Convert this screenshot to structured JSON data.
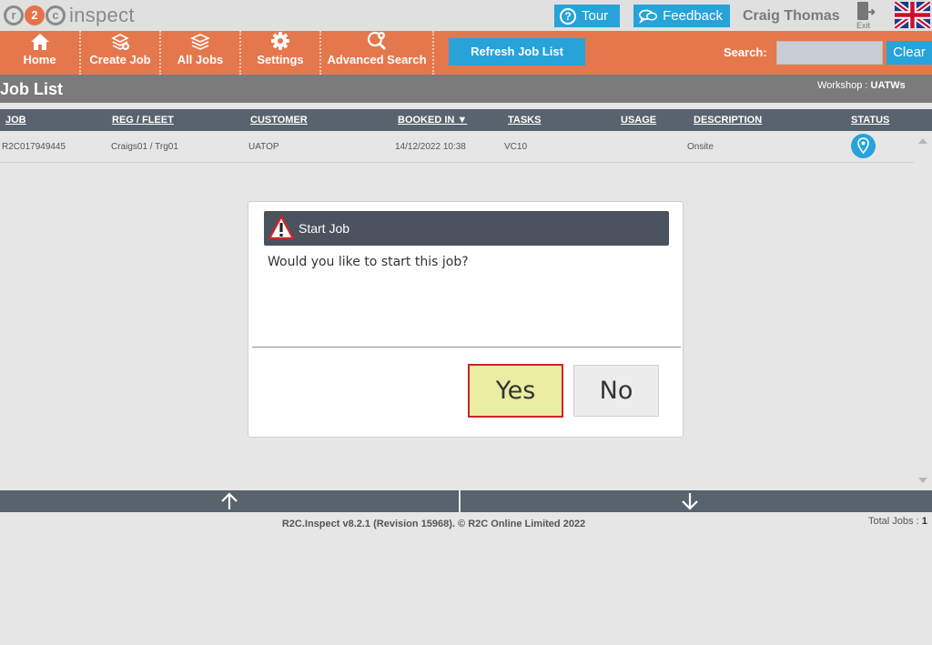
{
  "app": {
    "logo_letters": [
      "r",
      "2",
      "c"
    ],
    "logo_text": "inspect"
  },
  "topbar": {
    "tour_label": "Tour",
    "tour_icon": "?",
    "feedback_label": "Feedback",
    "user_name": "Craig Thomas",
    "exit_label": "Exit",
    "flag": "uk-flag-icon"
  },
  "nav": {
    "items": [
      {
        "label": "Home",
        "icon": "home-icon"
      },
      {
        "label": "Create Job",
        "icon": "create-job-icon"
      },
      {
        "label": "All Jobs",
        "icon": "all-jobs-icon"
      },
      {
        "label": "Settings",
        "icon": "gear-icon"
      },
      {
        "label": "Advanced Search",
        "icon": "advanced-search-icon"
      }
    ],
    "refresh_label": "Refresh Job List",
    "search_label": "Search:",
    "search_value": "",
    "clear_label": "Clear"
  },
  "page": {
    "title": "Job List",
    "workshop_label": "Workshop :",
    "workshop_value": "UATWs"
  },
  "table": {
    "headers": {
      "job": "JOB",
      "reg": "REG / FLEET",
      "customer": "CUSTOMER",
      "booked_in": "BOOKED IN ▼",
      "tasks": "TASKS",
      "usage": "USAGE",
      "description": "DESCRIPTION",
      "status": "STATUS"
    },
    "rows": [
      {
        "job": "R2C017949445",
        "reg": "Craigs01 / Trg01",
        "customer": "UATOP",
        "booked_in": "14/12/2022 10:38",
        "tasks": "VC10",
        "usage": "",
        "description": "Onsite",
        "status_icon": "map-pin-icon"
      }
    ]
  },
  "dialog": {
    "title": "Start Job",
    "message": "Would you like to start this job?",
    "yes_label": "Yes",
    "no_label": "No"
  },
  "footer": {
    "copyright": "R2C.Inspect v8.2.1 (Revision 15968). © R2C Online Limited 2022",
    "total_label": "Total Jobs :",
    "total_value": "1"
  },
  "colors": {
    "nav_orange": "#e5774d",
    "accent_blue": "#27a3d9",
    "header_slate": "#59636e",
    "dialog_header": "#4a525e",
    "yes_highlight": "#eaeda2",
    "yes_border": "#c9252c"
  }
}
